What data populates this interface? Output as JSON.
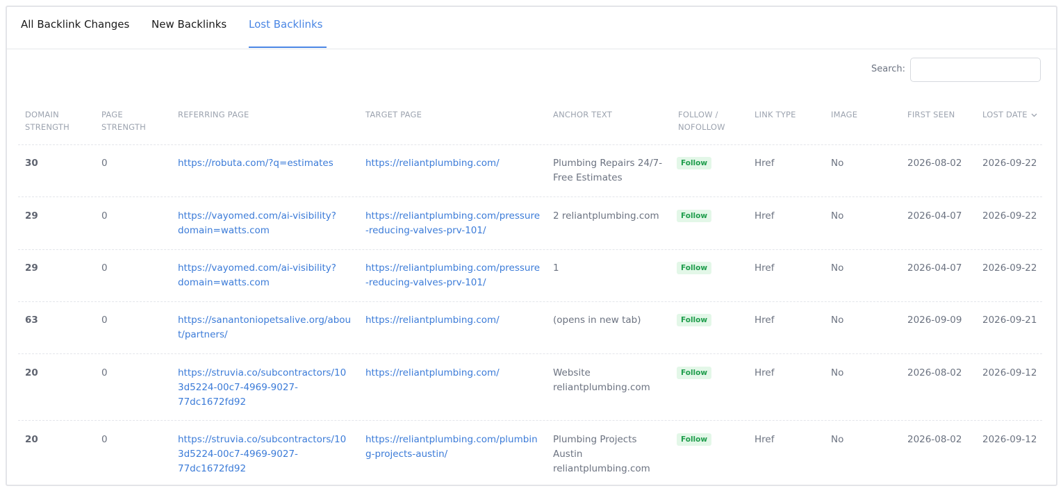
{
  "tabs": [
    {
      "label": "All Backlink Changes",
      "active": false
    },
    {
      "label": "New Backlinks",
      "active": false
    },
    {
      "label": "Lost Backlinks",
      "active": true
    }
  ],
  "search": {
    "label": "Search:",
    "value": "",
    "placeholder": ""
  },
  "columns": [
    {
      "label": "DOMAIN\nSTRENGTH"
    },
    {
      "label": "PAGE\nSTRENGTH"
    },
    {
      "label": "REFERRING PAGE"
    },
    {
      "label": "TARGET PAGE"
    },
    {
      "label": "ANCHOR TEXT"
    },
    {
      "label": "FOLLOW /\nNOFOLLOW"
    },
    {
      "label": "LINK TYPE"
    },
    {
      "label": "IMAGE"
    },
    {
      "label": "FIRST SEEN"
    },
    {
      "label": "LOST DATE",
      "sort": "descending",
      "sort_icon": "chevron-down-icon"
    }
  ],
  "rows": [
    {
      "domain_strength": "30",
      "page_strength": "0",
      "referring_page": "https://robuta.com/?q=estimates",
      "target_page": "https://reliantplumbing.com/",
      "anchor_text": "Plumbing Repairs 24/7-\nFree Estimates",
      "follow": "Follow",
      "link_type": "Href",
      "image": "No",
      "first_seen": "2026-08-02",
      "lost_date": "2026-09-22"
    },
    {
      "domain_strength": "29",
      "page_strength": "0",
      "referring_page": "https://vayomed.com/ai-visibility?\ndomain=watts.com",
      "target_page": "https://reliantplumbing.com/pressure\n-reducing-valves-prv-101/",
      "anchor_text": "2 reliantplumbing.com",
      "follow": "Follow",
      "link_type": "Href",
      "image": "No",
      "first_seen": "2026-04-07",
      "lost_date": "2026-09-22"
    },
    {
      "domain_strength": "29",
      "page_strength": "0",
      "referring_page": "https://vayomed.com/ai-visibility?\ndomain=watts.com",
      "target_page": "https://reliantplumbing.com/pressure\n-reducing-valves-prv-101/",
      "anchor_text": "1",
      "follow": "Follow",
      "link_type": "Href",
      "image": "No",
      "first_seen": "2026-04-07",
      "lost_date": "2026-09-22"
    },
    {
      "domain_strength": "63",
      "page_strength": "0",
      "referring_page": "https://sanantoniopetsalive.org/abou\nt/partners/",
      "target_page": "https://reliantplumbing.com/",
      "anchor_text": "(opens in new tab)",
      "follow": "Follow",
      "link_type": "Href",
      "image": "No",
      "first_seen": "2026-09-09",
      "lost_date": "2026-09-21"
    },
    {
      "domain_strength": "20",
      "page_strength": "0",
      "referring_page": "https://struvia.co/subcontractors/10\n3d5224-00c7-4969-9027-\n77dc1672fd92",
      "target_page": "https://reliantplumbing.com/",
      "anchor_text": "Website\nreliantplumbing.com",
      "follow": "Follow",
      "link_type": "Href",
      "image": "No",
      "first_seen": "2026-08-02",
      "lost_date": "2026-09-12"
    },
    {
      "domain_strength": "20",
      "page_strength": "0",
      "referring_page": "https://struvia.co/subcontractors/10\n3d5224-00c7-4969-9027-\n77dc1672fd92",
      "target_page": "https://reliantplumbing.com/plumbin\ng-projects-austin/",
      "anchor_text": "Plumbing Projects\nAustin\nreliantplumbing.com",
      "follow": "Follow",
      "link_type": "Href",
      "image": "No",
      "first_seen": "2026-08-02",
      "lost_date": "2026-09-12"
    }
  ],
  "colors": {
    "accent": "#4a86e4",
    "link": "#3b7bd8",
    "follow_badge_bg": "#e3f7e8",
    "follow_badge_text": "#1f9d4c"
  }
}
